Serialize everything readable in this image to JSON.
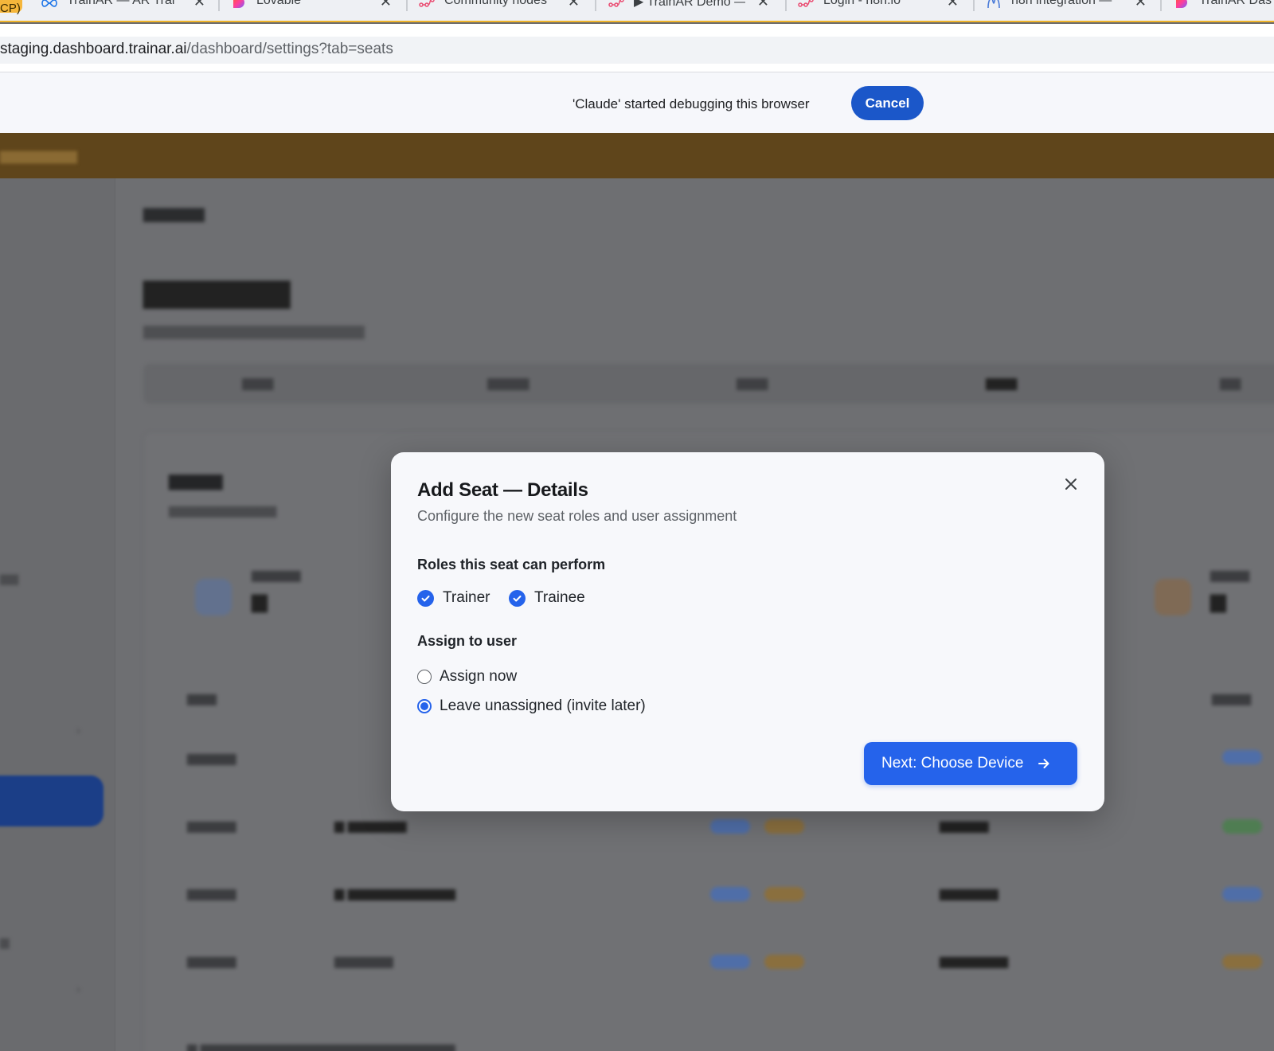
{
  "browser": {
    "tab_group_label": "CP)",
    "tabs": [
      {
        "label": "TrainAR — AR Trai",
        "icon": "infinity-icon"
      },
      {
        "label": "Lovable",
        "icon": "lovable-icon"
      },
      {
        "label": "Community nodes",
        "icon": "n8n-icon"
      },
      {
        "label": "▶ TrainAR Demo —",
        "icon": "n8n-icon"
      },
      {
        "label": "Login - n8n.io",
        "icon": "n8n-icon"
      },
      {
        "label": "n8n integration —",
        "icon": "claude-icon"
      },
      {
        "label": "TrainAR Das",
        "icon": "lovable-icon"
      }
    ],
    "url_host": "staging.dashboard.trainar.ai",
    "url_path": "/dashboard/settings?tab=seats",
    "debug_message": "'Claude' started debugging this browser",
    "debug_cancel": "Cancel"
  },
  "modal": {
    "title": "Add Seat — Details",
    "description": "Configure the new seat roles and user assignment",
    "roles_label": "Roles this seat can perform",
    "roles": [
      {
        "label": "Trainer",
        "checked": true
      },
      {
        "label": "Trainee",
        "checked": true
      }
    ],
    "assign_label": "Assign to user",
    "assign_options": [
      {
        "label": "Assign now",
        "selected": false
      },
      {
        "label": "Leave unassigned (invite later)",
        "selected": true
      }
    ],
    "next_button": "Next: Choose Device"
  },
  "colors": {
    "accent": "#2563eb",
    "debug_button": "#1b57c9",
    "tab_underline": "#f0b429"
  }
}
